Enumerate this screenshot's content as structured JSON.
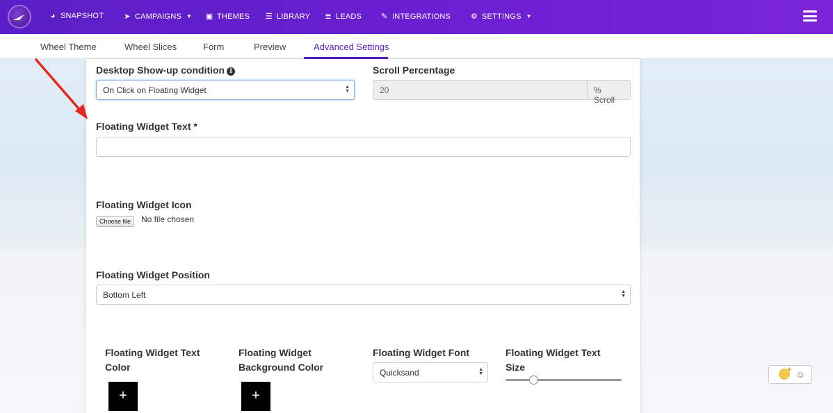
{
  "nav": {
    "items": [
      {
        "label": "SNAPSHOT",
        "icon": "dashboard-icon"
      },
      {
        "label": "CAMPAIGNS",
        "icon": "paper-plane-icon"
      },
      {
        "label": "THEMES",
        "icon": "image-icon"
      },
      {
        "label": "LIBRARY",
        "icon": "library-icon"
      },
      {
        "label": "LEADS",
        "icon": "list-icon"
      },
      {
        "label": "INTEGRATIONS",
        "icon": "plug-icon"
      },
      {
        "label": "SETTINGS",
        "icon": "cogs-icon"
      }
    ]
  },
  "tabs": [
    "Wheel Theme",
    "Wheel Slices",
    "Form",
    "Preview",
    "Advanced Settings"
  ],
  "active_tab": "Advanced Settings",
  "form": {
    "desktop_condition_label": "Desktop Show-up condition",
    "desktop_condition_value": "On Click on Floating Widget",
    "scroll_label": "Scroll Percentage",
    "scroll_value": "20",
    "scroll_addon": "% Scroll",
    "widget_text_label": "Floating Widget Text *",
    "widget_text_value": "",
    "widget_icon_label": "Floating Widget Icon",
    "choose_file_label": "Choose file",
    "no_file_text": "No file chosen",
    "position_label": "Floating Widget Position",
    "position_value": "Bottom Left",
    "text_color_label": "Floating Widget Text Color",
    "bg_color_label": "Floating Widget Background Color",
    "font_label": "Floating Widget Font",
    "font_value": "Quicksand",
    "text_size_label": "Floating Widget Text Size",
    "add_symbol": "+",
    "text_size_level": 0.22
  },
  "colors": {
    "brand_purple": "#5b1ec6",
    "annotation_red": "#e8261e"
  }
}
